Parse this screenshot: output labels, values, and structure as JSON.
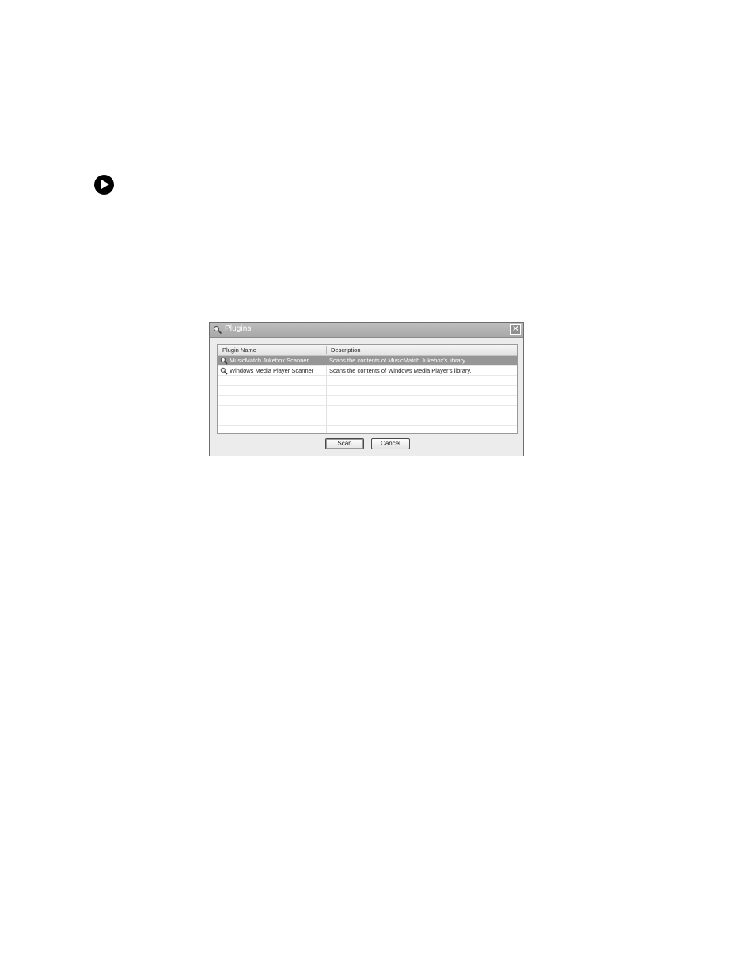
{
  "dialog": {
    "title": "Plugins",
    "close_glyph": "✕",
    "list": {
      "columns": [
        "Plugin Name",
        "Description"
      ],
      "rows": [
        {
          "name": "MusicMatch Jukebox Scanner",
          "description": "Scans the contents of MusicMatch Jukebox's library.",
          "selected": true,
          "icon": "magnifier-icon"
        },
        {
          "name": "Windows Media Player Scanner",
          "description": "Scans the contents of Windows Media Player's library.",
          "selected": false,
          "icon": "magnifier-icon"
        }
      ]
    },
    "buttons": {
      "scan_label": "Scan",
      "cancel_label": "Cancel"
    }
  },
  "page": {
    "bullet_icon": "arrow-bullet-icon"
  }
}
